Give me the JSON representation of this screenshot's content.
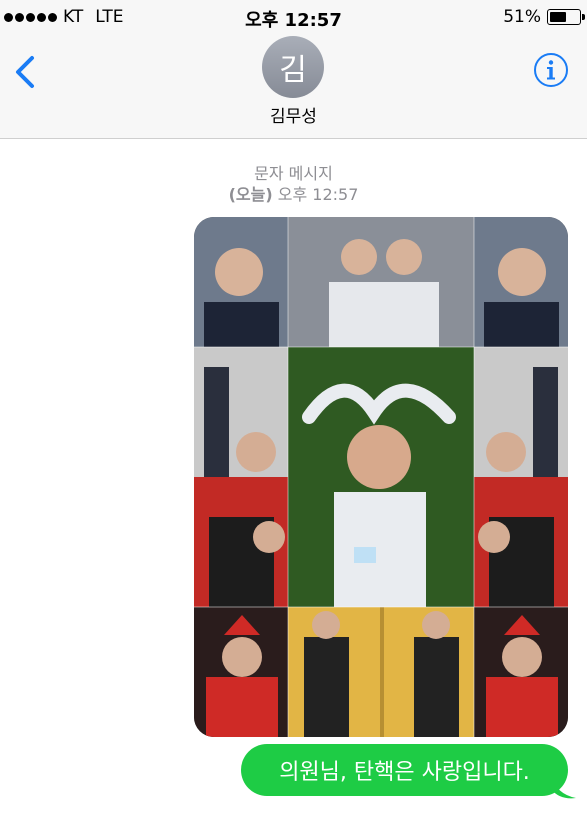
{
  "status_bar": {
    "carrier": "KT",
    "network": "LTE",
    "time": "오후 12:57",
    "battery_percent": "51%",
    "battery_level": 0.51,
    "signal_bars": 5
  },
  "header": {
    "avatar_initial": "김",
    "contact_name": "김무성",
    "back_icon": "chevron-left-icon",
    "info_icon": "info-icon",
    "accent_color": "#1a7cf5"
  },
  "conversation": {
    "message_type": "문자 메시지",
    "timestamp_day": "(오늘)",
    "timestamp_time": "오후 12:57",
    "attachment": {
      "kind": "photo-collage",
      "description_icon": "photo-attachment"
    },
    "message": {
      "text": "의원님, 탄핵은 사랑입니다.",
      "bubble_color": "#1ecc45"
    }
  }
}
